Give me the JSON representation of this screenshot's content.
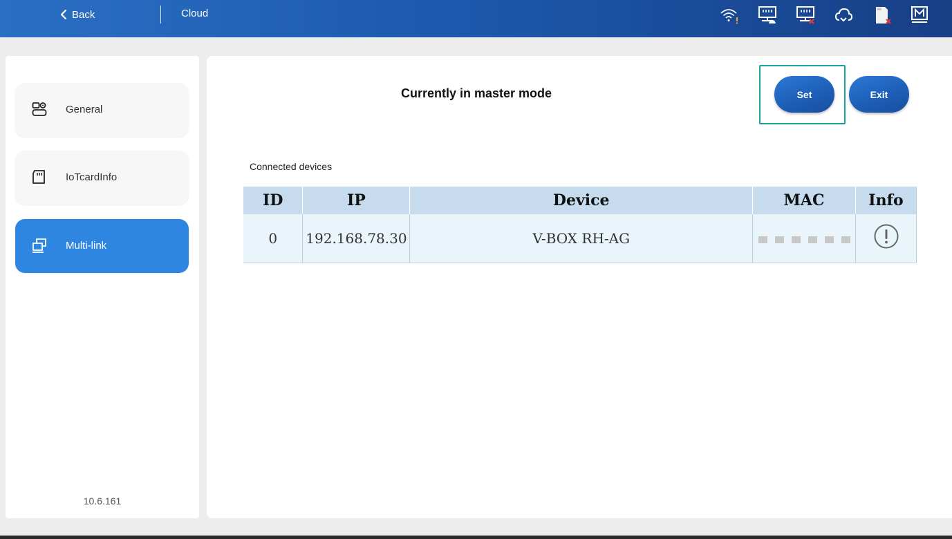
{
  "header": {
    "back_label": "Back",
    "title": "Cloud",
    "status_icons": [
      {
        "name": "wifi-warning-icon"
      },
      {
        "name": "network-connected-icon"
      },
      {
        "name": "network-error-icon"
      },
      {
        "name": "cloud-icon"
      },
      {
        "name": "sd-card-error-icon"
      },
      {
        "name": "m-mode-icon"
      }
    ]
  },
  "sidebar": {
    "items": [
      {
        "label": "General",
        "icon": "device-settings-icon",
        "active": false
      },
      {
        "label": "IoTcardInfo",
        "icon": "sim-card-icon",
        "active": false
      },
      {
        "label": "Multi-link",
        "icon": "multi-link-icon",
        "active": true
      }
    ],
    "version": "10.6.161"
  },
  "main": {
    "mode_title": "Currently in master mode",
    "set_label": "Set",
    "exit_label": "Exit",
    "section_label": "Connected devices",
    "table": {
      "headers": [
        "ID",
        "IP",
        "Device",
        "MAC",
        "Info"
      ],
      "rows": [
        {
          "id": "0",
          "ip": "192.168.78.30",
          "device": "V-BOX RH-AG",
          "mac": "",
          "info_icon": "info-icon"
        }
      ]
    }
  },
  "colors": {
    "header_start": "#2a6fc4",
    "header_end": "#173f86",
    "active_nav": "#2f86e0",
    "button": "#1d5fb8",
    "table_header": "#c6dcee",
    "table_row": "#eaf5fb",
    "highlight": "#1aa39a",
    "warning": "#f0a020",
    "error": "#e53935"
  }
}
